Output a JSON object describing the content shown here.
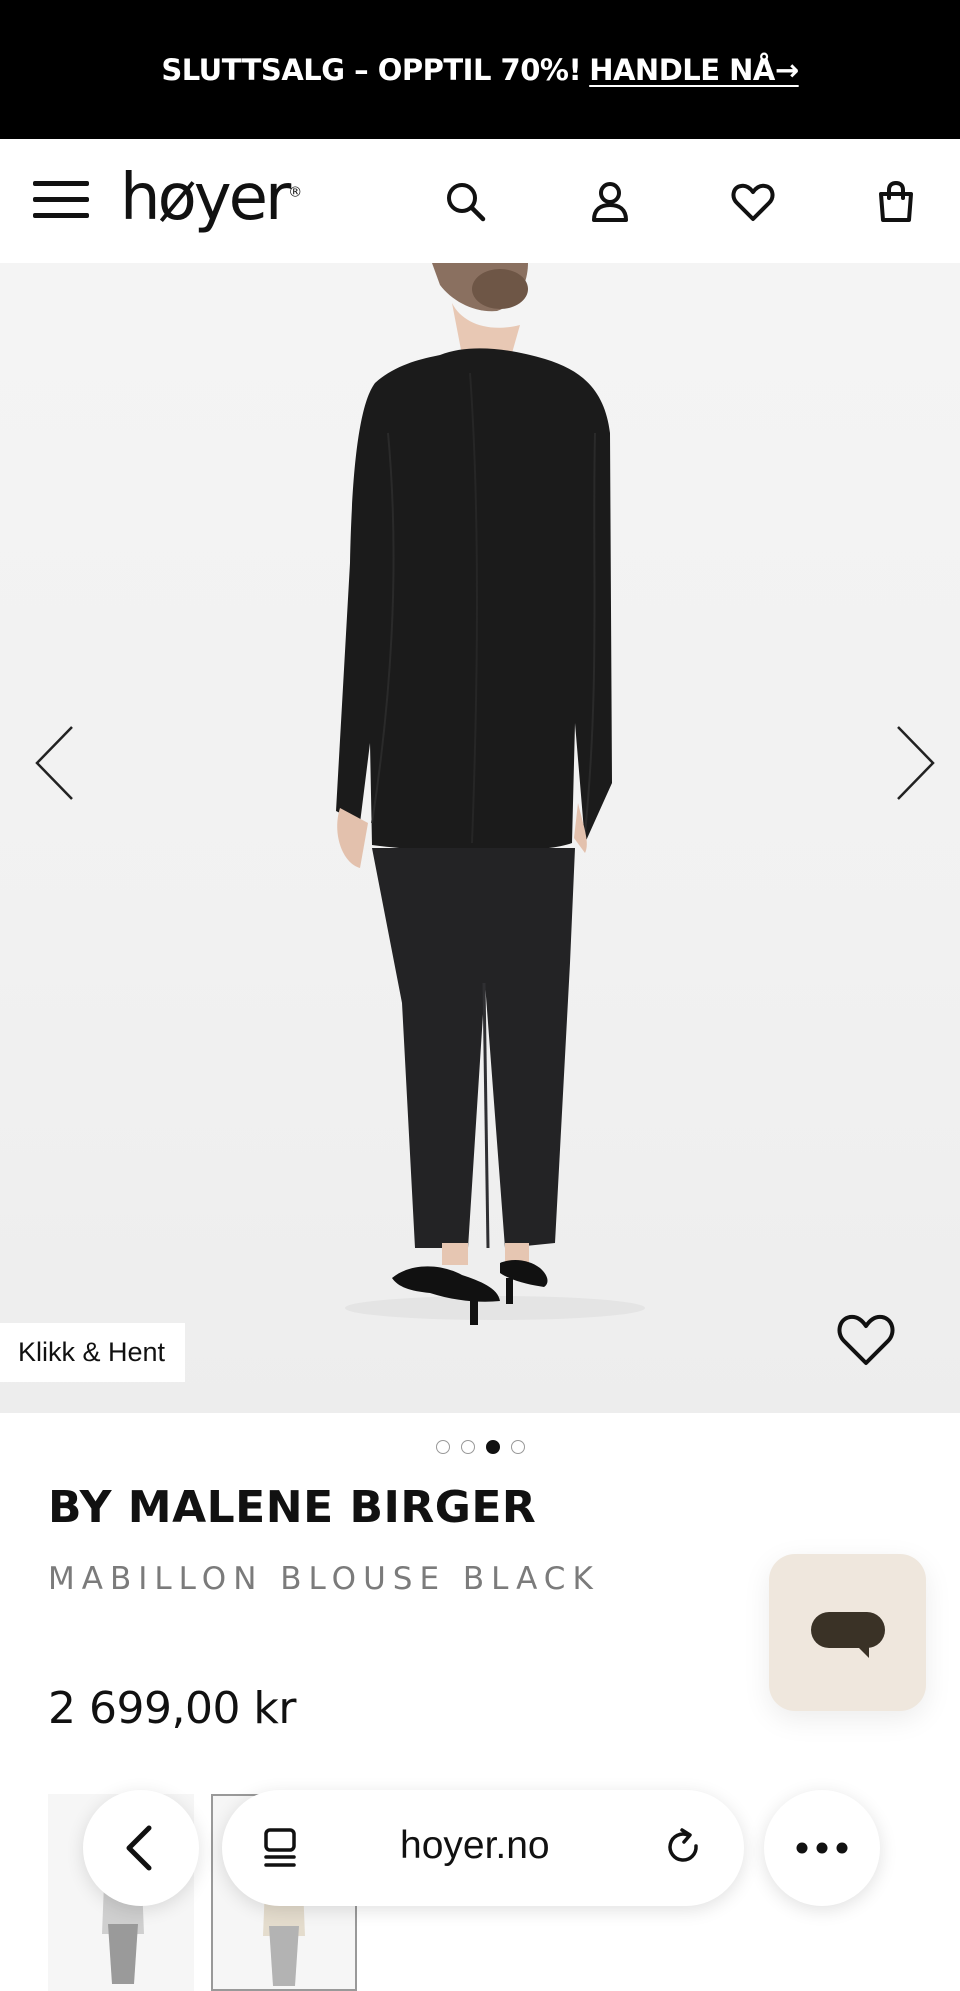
{
  "promo": {
    "text": "SLUTTSALG – OPPTIL 70%!",
    "link": "HANDLE NÅ→"
  },
  "header": {
    "logo": "høyer",
    "logo_mark": "®"
  },
  "icons": {
    "menu": "menu-icon",
    "search": "search-icon",
    "account": "user-icon",
    "wishlist": "heart-icon",
    "cart": "shopping-bag-icon"
  },
  "hero": {
    "badge": "Klikk & Hent",
    "image_count": 4,
    "active_image": 3
  },
  "product": {
    "brand": "BY MALENE BIRGER",
    "name": "MABILLON BLOUSE BLACK",
    "price": "2 699,00 kr"
  },
  "browser": {
    "url": "hoyer.no"
  },
  "colors": {
    "promo_bg": "#000000",
    "chat_bg": "#efe7dd",
    "chat_icon": "#3a3226"
  }
}
